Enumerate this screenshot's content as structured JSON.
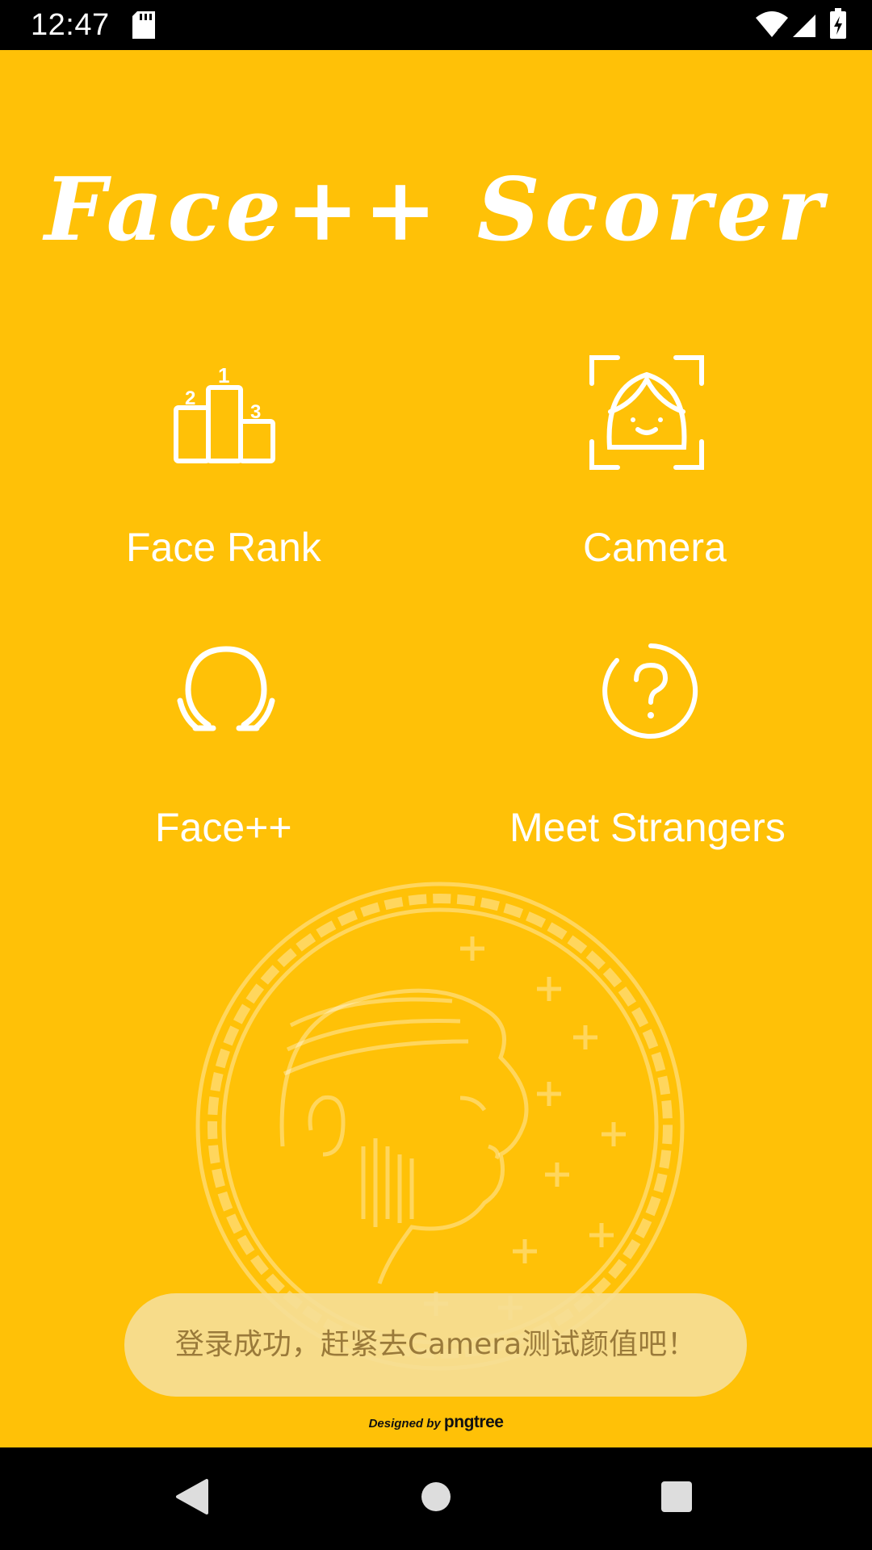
{
  "status_bar": {
    "time": "12:47",
    "icons": [
      "sd-card-icon",
      "wifi-icon",
      "signal-icon",
      "battery-charging-icon"
    ]
  },
  "app": {
    "title": "Face++ Scorer"
  },
  "menu": {
    "face_rank_label": "Face Rank",
    "camera_label": "Camera",
    "facepp_label": "Face++",
    "meet_strangers_label": "Meet Strangers"
  },
  "toast": {
    "message": "登录成功，赶紧去Camera测试颜值吧！"
  },
  "watermark": {
    "prefix": "Designed by",
    "brand": "pngtree"
  },
  "navigation_bar": {
    "icons": [
      "back-icon",
      "home-icon",
      "recents-icon"
    ]
  },
  "colors": {
    "background": "#FFC107",
    "foreground": "#FFFFFF",
    "system_bars": "#000000"
  }
}
